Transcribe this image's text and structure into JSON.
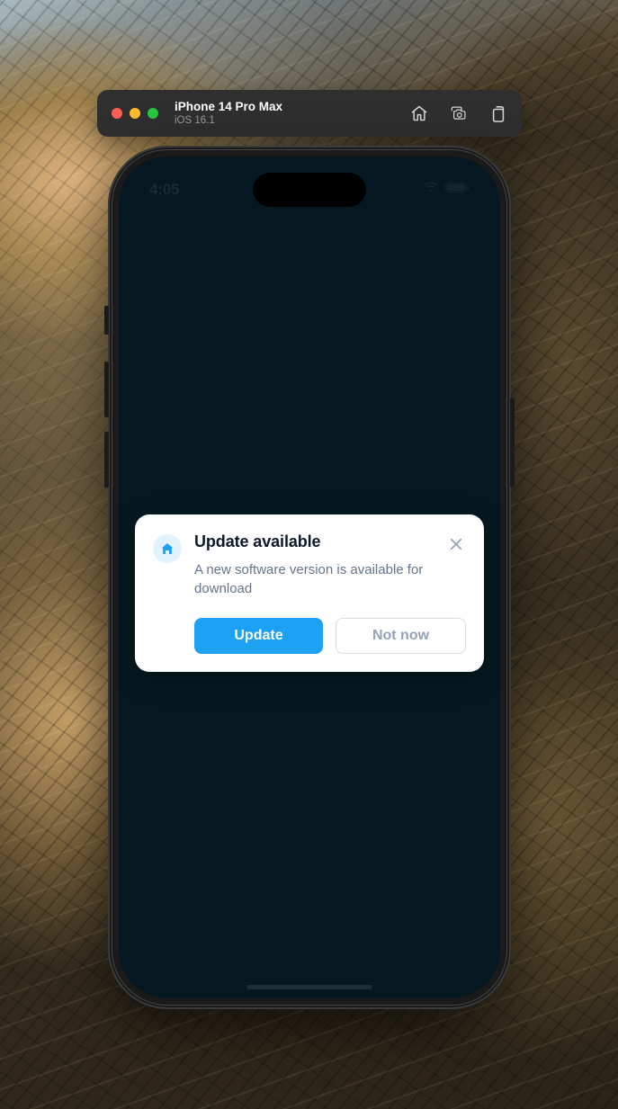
{
  "simulator": {
    "device_name": "iPhone 14 Pro Max",
    "os_version": "iOS 16.1"
  },
  "status_bar": {
    "time": "4:05"
  },
  "modal": {
    "title": "Update available",
    "description": "A new software version is available for download",
    "primary_button": "Update",
    "secondary_button": "Not now"
  }
}
